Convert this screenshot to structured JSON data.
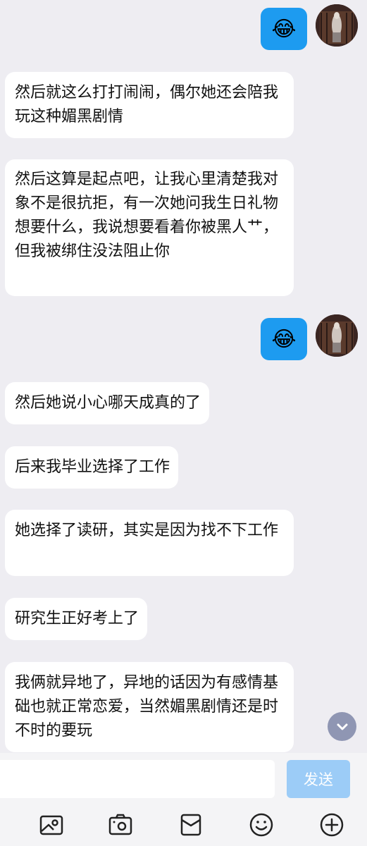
{
  "messages": [
    {
      "text": "然后就这么打打闹闹，偶尔她还会陪我玩这种媚黑剧情"
    },
    {
      "text": "然后这算是起点吧，让我心里清楚我对象不是很抗拒，有一次她问我生日礼物想要什么，我说想要看着你被黑人艹，但我被绑住没法阻止你"
    },
    {
      "text": "然后她说小心哪天成真的了"
    },
    {
      "text": "后来我毕业选择了工作"
    },
    {
      "text": "她选择了读研，其实是因为找不下工作"
    },
    {
      "text": "研究生正好考上了"
    },
    {
      "text": "我俩就异地了，异地的话因为有感情基础也就正常恋爱，当然媚黑剧情还是时不时的要玩"
    }
  ],
  "outgoing_emoji": "😂",
  "input": {
    "value": "",
    "placeholder": ""
  },
  "send_label": "发送",
  "colors": {
    "accent": "#1d9bf0",
    "send_disabled": "#9cccf7",
    "background": "#eeedf2"
  },
  "toolbar_icons": [
    "image-icon",
    "camera-icon",
    "red-packet-icon",
    "emoji-icon",
    "plus-icon"
  ]
}
